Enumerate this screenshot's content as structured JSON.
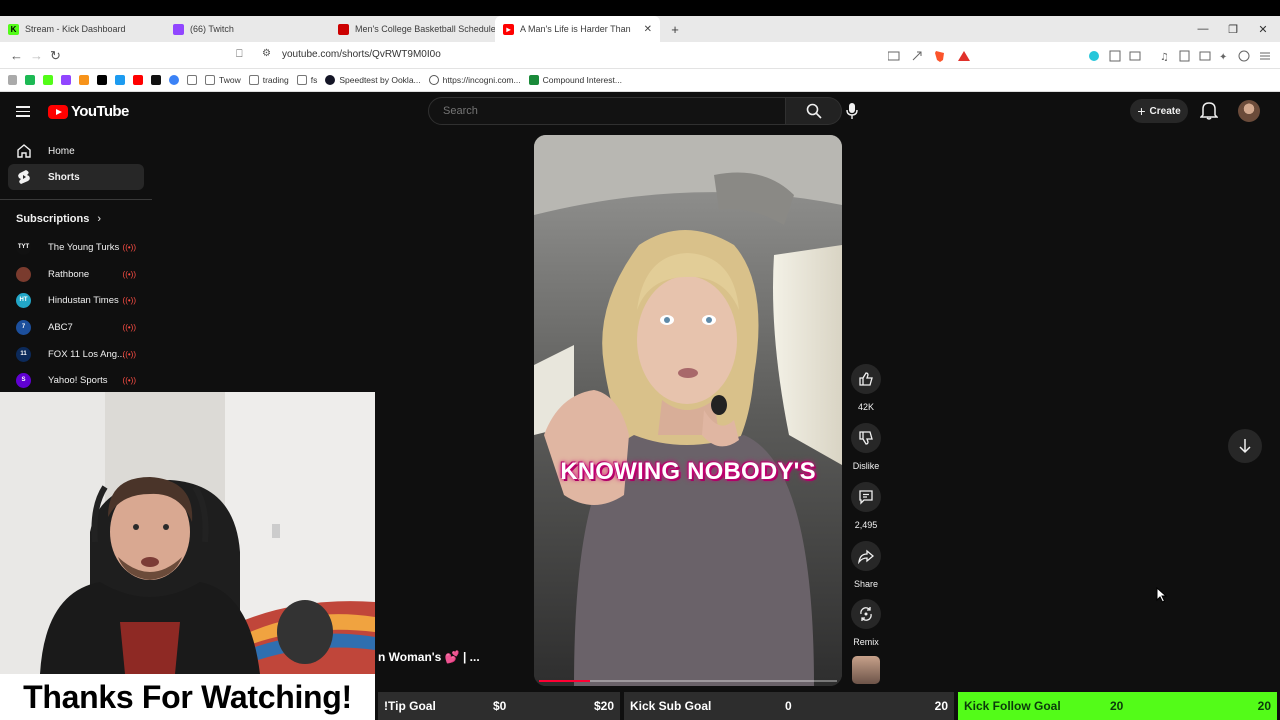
{
  "browser": {
    "tabs": [
      {
        "title": "Stream - Kick Dashboard",
        "favicon_color": "#53fc18",
        "favicon_text": "K",
        "active": false
      },
      {
        "title": "(66) Twitch",
        "favicon_color": "#9146ff",
        "favicon_text": "",
        "active": false
      },
      {
        "title": "Men's College Basketball Schedule -",
        "favicon_color": "#cc0000",
        "favicon_text": "",
        "active": false
      },
      {
        "title": "A Man's Life is Harder Than",
        "favicon_color": "#ff0000",
        "favicon_text": "",
        "active": true
      }
    ],
    "new_tab": "+",
    "url": "youtube.com/shorts/QvRWT9M0I0o",
    "bookmarks": [
      {
        "label": "",
        "color": "#1db954"
      },
      {
        "label": "",
        "color": "#53fc18"
      },
      {
        "label": "",
        "color": "#9146ff"
      },
      {
        "label": "",
        "color": "#f7931a"
      },
      {
        "label": "",
        "color": "#000000"
      },
      {
        "label": "",
        "color": "#1d9bf0"
      },
      {
        "label": "",
        "color": "#ff0000"
      },
      {
        "label": "",
        "color": "#111111"
      },
      {
        "label": "",
        "color": "#3b82f6"
      },
      {
        "label": "",
        "color": "#888888"
      },
      {
        "label": "Twow",
        "color": "#888888"
      },
      {
        "label": "trading",
        "color": "#888888"
      },
      {
        "label": "fs",
        "color": "#888888"
      },
      {
        "label": "Speedtest by Ookla...",
        "color": "#141526"
      },
      {
        "label": "https://incogni.com...",
        "color": "#555555"
      },
      {
        "label": "Compound Interest...",
        "color": "#1a8a3a"
      }
    ]
  },
  "youtube": {
    "logo_text": "YouTube",
    "search_placeholder": "Search",
    "create_label": "Create",
    "nav": [
      {
        "label": "Home",
        "icon": "home-icon",
        "active": false
      },
      {
        "label": "Shorts",
        "icon": "shorts-icon",
        "active": true
      }
    ],
    "subscriptions_title": "Subscriptions",
    "subscriptions": [
      {
        "name": "The Young Turks",
        "avatar_text": "TYT",
        "color": "#111111"
      },
      {
        "name": "Rathbone",
        "avatar_text": "",
        "color": "#7a3b2e"
      },
      {
        "name": "Hindustan Times",
        "avatar_text": "HT",
        "color": "#22a6c7"
      },
      {
        "name": "ABC7",
        "avatar_text": "7",
        "color": "#1c4f9c"
      },
      {
        "name": "FOX 11 Los Ang...",
        "avatar_text": "11",
        "color": "#0c2a5a"
      },
      {
        "name": "Yahoo! Sports",
        "avatar_text": "S",
        "color": "#6001d2"
      }
    ],
    "short": {
      "caption": "KNOWING NOBODY'S",
      "title_fragment": "n Woman's",
      "title_suffix": "| ...",
      "progress": 0.17,
      "actions": [
        {
          "icon": "thumbs-up-icon",
          "label": "42K"
        },
        {
          "icon": "thumbs-down-icon",
          "label": "Dislike"
        },
        {
          "icon": "comment-icon",
          "label": "2,495"
        },
        {
          "icon": "share-icon",
          "label": "Share"
        },
        {
          "icon": "remix-icon",
          "label": "Remix"
        }
      ]
    }
  },
  "overlay": {
    "thanks_text": "Thanks For Watching!",
    "goals": [
      {
        "name": "!Tip Goal",
        "current": "$0",
        "target": "$20",
        "color": "#2d2d2d"
      },
      {
        "name": "Kick Sub Goal",
        "current": "0",
        "target": "20",
        "color": "#2d2d2d"
      },
      {
        "name": "Kick Follow Goal",
        "current": "20",
        "target": "20",
        "color": "#53fc18"
      }
    ]
  }
}
